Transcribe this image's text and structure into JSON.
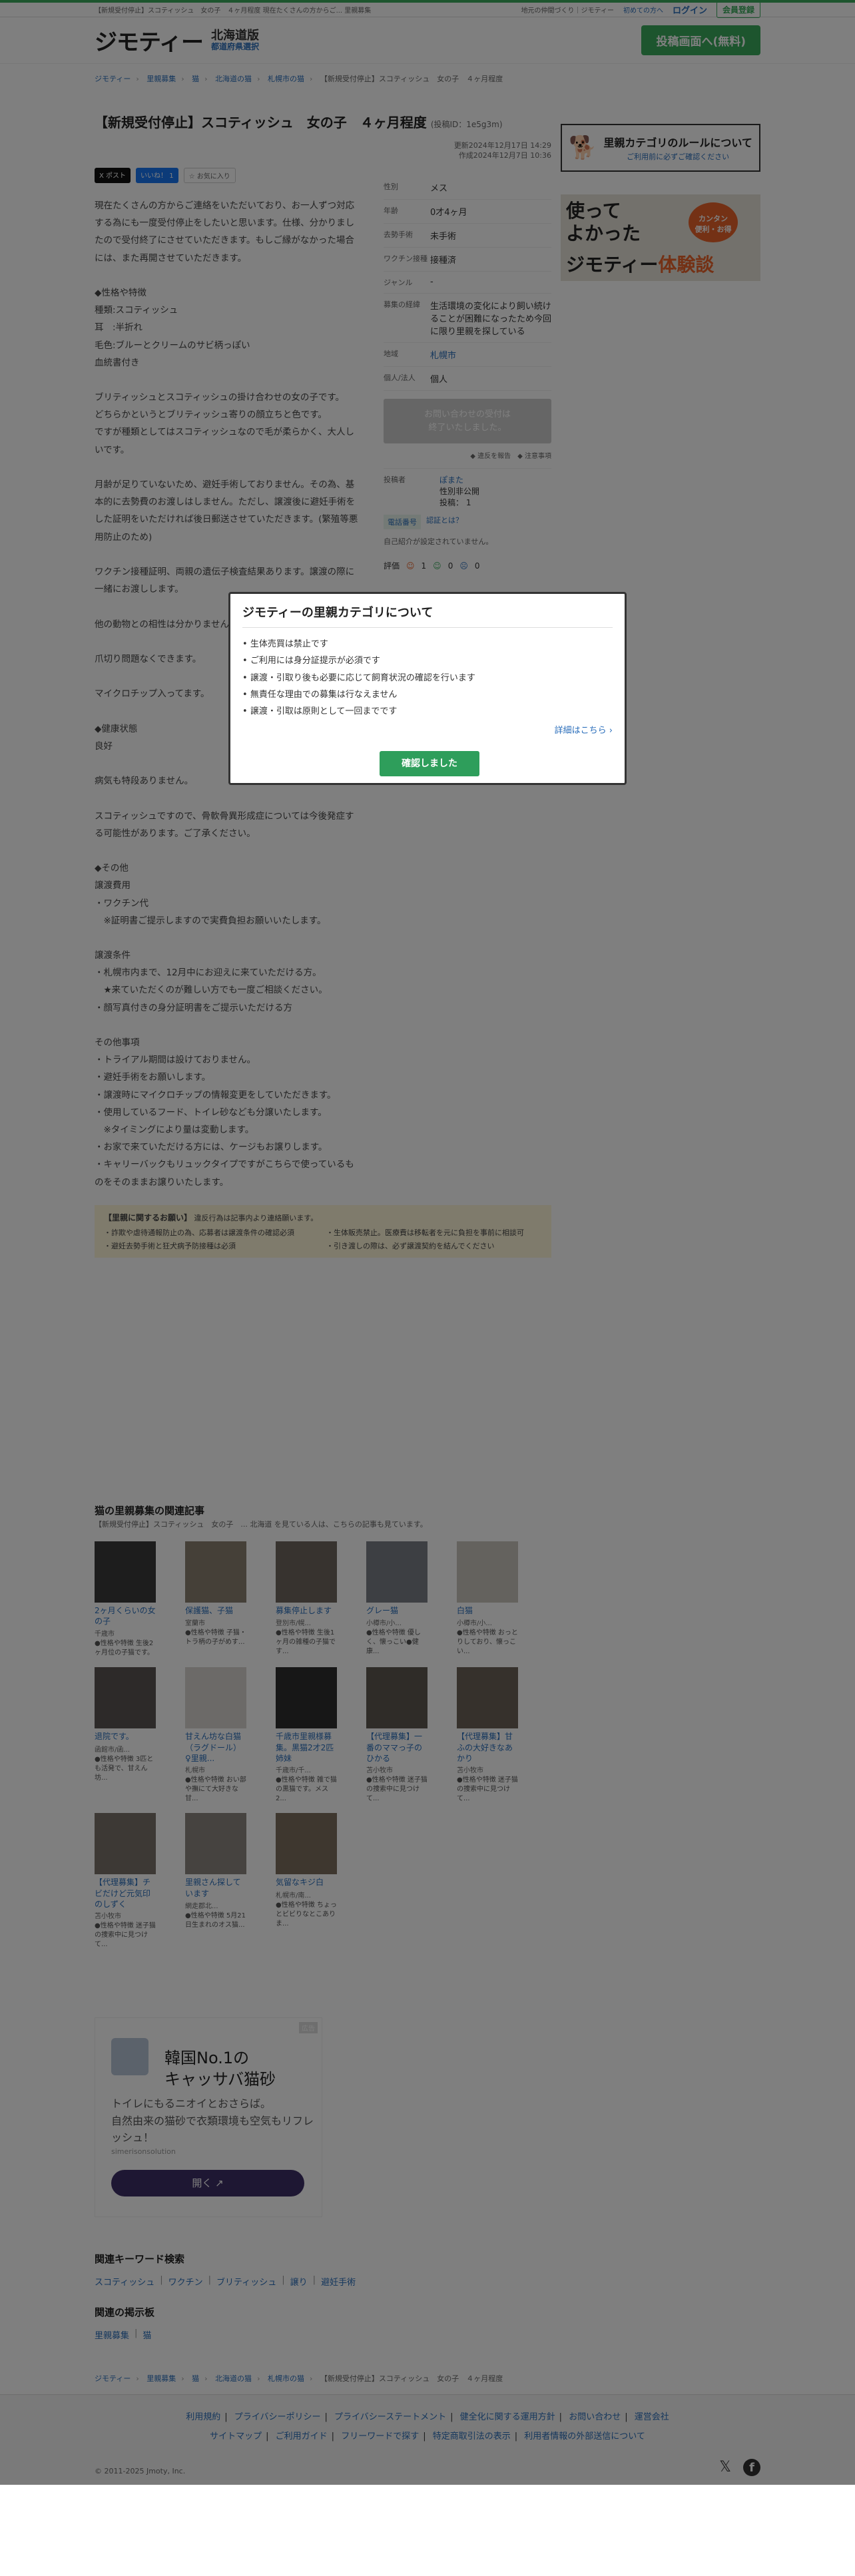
{
  "topbar": {
    "ticker": "【新規受付停止】スコティッシュ　女の子　４ヶ月程度 現在たくさんの方からご... 里親募集",
    "link1": "地元の仲間づくり｜ジモティー",
    "link2": "初めての方へ",
    "login": "ログイン",
    "register": "会員登録"
  },
  "header": {
    "logo": "ジモティー",
    "region": "北海道版",
    "region_select": "都道府県選択",
    "post_button": "投稿画面へ(無料)"
  },
  "breadcrumbs": [
    "ジモティー",
    "里親募集",
    "猫",
    "北海道の猫",
    "札幌市の猫",
    "【新規受付停止】スコティッシュ　女の子　４ヶ月程度"
  ],
  "listing": {
    "title": "【新規受付停止】スコティッシュ　女の子　４ヶ月程度",
    "id": "(投稿ID：1e5g3m)",
    "updated": "更新2024年12月17日 14:29",
    "created": "作成2024年12月7日 10:36",
    "share_x": "X ポスト",
    "share_fb": "いいね！ 1",
    "share_fav": "☆ お気に入り",
    "description": "現在たくさんの方からご連絡をいただいており、お一人ずつ対応する為にも一度受付停止をしたいと思います。仕様、分かりましたので受付終了にさせていただきます。もしご縁がなかった場合には、また再開させていただきます。\n\n◆性格や特徴\n種類:スコティッシュ\n耳　:半折れ\n毛色:ブルーとクリームのサビ柄っぽい\n血統書付き\n\nブリティッシュとスコティッシュの掛け合わせの女の子です。\nどちらかというとブリティッシュ寄りの顔立ちと色です。\nですが種類としてはスコティッシュなので毛が柔らかく、大人しいです。\n\n月齢が足りていないため、避妊手術しておりません。その為、基本的に去勢費のお渡しはしません。ただし、譲渡後に避妊手術をした証明をいただければ後日郵送させていただきます。(繁殖等悪用防止のため)\n\nワクチン接種証明、両親の遺伝子検査結果あります。譲渡の際に一緒にお渡しします。\n\n他の動物との相性は分かりません。\n\n爪切り問題なくできます。\n\nマイクロチップ入ってます。\n\n◆健康状態\n良好\n\n病気も特段ありません。\n\nスコティッシュですので、骨軟骨異形成症については今後発症する可能性があります。ご了承ください。\n\n◆その他\n譲渡費用\n・ワクチン代\n　※証明書ご提示しますので実費負担お願いいたします。\n\n譲渡条件\n・札幌市内まで、12月中にお迎えに来ていただける方。\n　★来ていただくのが難しい方でも一度ご相談ください。\n・顔写真付きの身分証明書をご提示いただける方\n\nその他事項\n・トライアル期間は設けておりません。\n・避妊手術をお願いします。\n・譲渡時にマイクロチップの情報変更をしていただきます。\n・使用しているフード、トイレ砂なども分譲いたします。\n　※タイミングにより量は変動します。\n・お家で来ていただける方には、ケージもお譲りします。\n・キャリーバックもリュックタイプですがこちらで使っているものをそのままお譲りいたします。\n\nよろしくおねがいします。",
    "specs": [
      {
        "k": "性別",
        "v": "メス"
      },
      {
        "k": "年齢",
        "v": "0才4ヶ月"
      },
      {
        "k": "去勢手術",
        "v": "未手術"
      },
      {
        "k": "ワクチン接種",
        "v": "接種済"
      },
      {
        "k": "ジャンル",
        "v": "-"
      },
      {
        "k": "募集の経緯",
        "v": "生活環境の変化により飼い続けることが困難になったため今回に限り里親を探している"
      },
      {
        "k": "地域",
        "v": "札幌市"
      },
      {
        "k": "個人/法人",
        "v": "個人"
      }
    ],
    "closed_button": "お問い合わせの受付は\n終了いたしました。",
    "report": "◆ 違反を報告　◆ 注意事項",
    "poster_label": "投稿者",
    "poster_name": "ぽまた",
    "poster_gender": "性別非公開",
    "poster_count": "投稿： 1",
    "badge1": "電話番号",
    "badge2": "認証とは？",
    "intro": "自己紹介が設定されていません。",
    "rating_label": "評価",
    "rating_good": "1",
    "rating_normal": "0",
    "rating_bad": "0"
  },
  "side": {
    "rules_title": "里親カテゴリのルールについて",
    "rules_sub": "ご利用前に必ずご確認ください",
    "banner_line1": "使って\nよかった",
    "banner_badge": "カンタン\n便利・お得",
    "banner_logo": "ジモティー",
    "banner_accent": "体験談"
  },
  "notice": {
    "title": "【里親に関するお願い】",
    "title_sub": "違反行為は記事内より連絡願います。",
    "items": [
      "・詐欺や虐待通報防止の為、応募者は譲渡条件の確認必須",
      "・生体販売禁止。医療費は移転者を元に負担を事前に相談可",
      "・避妊去勢手術と狂犬病予防接種は必須",
      "・引き渡しの際は、必ず譲渡契約を結んでください"
    ]
  },
  "related": {
    "title": "猫の里親募集の関連記事",
    "subtitle": "【新規受付停止】スコティッシュ　女の子　... 北海道 を見ている人は、こちらの記事も見ています。",
    "cards": [
      {
        "t": "2ヶ月くらいの女の子",
        "l": "千歳市",
        "d": "●性格や特徴 生後2ヶ月位の子猫です。",
        "c": "#3b3b3b"
      },
      {
        "t": "保護猫、子猫",
        "l": "室蘭市",
        "d": "●性格や特徴 子猫・トラ柄の子がめす...",
        "c": "#8a8070"
      },
      {
        "t": "募集停止します",
        "l": "登別市/幌...",
        "d": "●性格や特徴 生後1ヶ月の雑種の子猫です...",
        "c": "#6e675e"
      },
      {
        "t": "グレー猫",
        "l": "小樽市/小...",
        "d": "●性格や特徴 優しく、懐っこい●健康...",
        "c": "#7b7f86"
      },
      {
        "t": "白猫",
        "l": "小樽市/小...",
        "d": "●性格や特徴 おっとりしており、懐っこい...",
        "c": "#c9c4bc"
      },
      {
        "t": "退院です。",
        "l": "函館市/函...",
        "d": "●性格や特徴 3匹とも活発で、甘えん坊...",
        "c": "#5b5553"
      },
      {
        "t": "甘えん坊な白猫（ラグドール）♀里親...",
        "l": "札幌市",
        "d": "●性格や特徴 おい部や撫にて大好きな甘...",
        "c": "#d8d5d0"
      },
      {
        "t": "千歳市里親様募集。黒猫2才2匹姉妹",
        "l": "千歳市/千...",
        "d": "●性格や特徴 雑で猫の黒猫です。メス2...",
        "c": "#2e2e2e"
      },
      {
        "t": "【代理募集】一番のママっ子のひかる",
        "l": "苫小牧市",
        "d": "●性格や特徴 迷子猫の捜索中に見つけて...",
        "c": "#5f5850"
      },
      {
        "t": "【代理募集】甘ふの大好きなあかり",
        "l": "苫小牧市",
        "d": "●性格や特徴 迷子猫の捜索中に見つけて...",
        "c": "#6d6358"
      },
      {
        "t": "【代理募集】チビだけど元気印のしずく",
        "l": "苫小牧市",
        "d": "●性格や特徴 迷子猫の捜索中に見つけて...",
        "c": "#7a736a"
      },
      {
        "t": "里親さん探しています",
        "l": "網走郡北...",
        "d": "●性格や特徴 5月21日生まれのオス猫...",
        "c": "#8d8680"
      },
      {
        "t": "気留なキジ白",
        "l": "札幌市/南...",
        "d": "●性格や特徴 ちょっとビビりなとこありま...",
        "c": "#7c6e5e"
      }
    ]
  },
  "ad": {
    "tag": "広告",
    "title": "韓国No.1の\nキャッサバ猫砂",
    "body": "トイレにもるニオイとおさらば。\n自然由来の猫砂で衣類環境も空気もリフレッシュ！",
    "domain": "simerisonsolution",
    "button": "開く ↗"
  },
  "keywords": {
    "title": "関連キーワード検索",
    "items": [
      "スコティッシュ",
      "ワクチン",
      "ブリティッシュ",
      "譲り",
      "避妊手術"
    ],
    "board_title": "関連の掲示板",
    "board_items": [
      "里親募集",
      "猫"
    ]
  },
  "footer": {
    "line1": [
      "利用規約",
      "プライバシーポリシー",
      "プライバシーステートメント",
      "健全化に関する運用方針",
      "お問い合わせ",
      "運営会社"
    ],
    "line2": [
      "サイトマップ",
      "ご利用ガイド",
      "フリーワードで探す",
      "特定商取引法の表示",
      "利用者情報の外部送信について"
    ],
    "copyright": "© 2011-2025 Jmoty, Inc."
  },
  "modal": {
    "title": "ジモティーの里親カテゴリについて",
    "items": [
      "生体売買は禁止です",
      "ご利用には身分証提示が必須です",
      "譲渡・引取り後も必要に応じて飼育状況の確認を行います",
      "無責任な理由での募集は行なえません",
      "譲渡・引取は原則として一回までです"
    ],
    "more": "詳細はこちら ›",
    "ok": "確認しました"
  }
}
